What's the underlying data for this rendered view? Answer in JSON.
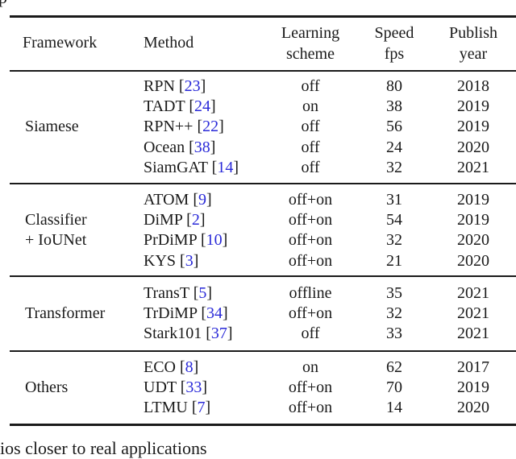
{
  "top_fragment": "p",
  "table": {
    "headers": {
      "framework": "Framework",
      "method": "Method",
      "learning_line1": "Learning",
      "learning_line2": "scheme",
      "speed_line1": "Speed",
      "speed_line2": "fps",
      "year_line1": "Publish",
      "year_line2": "year"
    },
    "groups": [
      {
        "framework": [
          "Siamese"
        ],
        "rows": [
          {
            "method": "RPN",
            "cite": "23",
            "scheme": "off",
            "fps": "80",
            "year": "2018"
          },
          {
            "method": "TADT",
            "cite": "24",
            "scheme": "on",
            "fps": "38",
            "year": "2019"
          },
          {
            "method": "RPN++",
            "cite": "22",
            "scheme": "off",
            "fps": "56",
            "year": "2019"
          },
          {
            "method": "Ocean",
            "cite": "38",
            "scheme": "off",
            "fps": "24",
            "year": "2020"
          },
          {
            "method": "SiamGAT",
            "cite": "14",
            "scheme": "off",
            "fps": "32",
            "year": "2021"
          }
        ]
      },
      {
        "framework": [
          "Classifier",
          "+ IoUNet"
        ],
        "rows": [
          {
            "method": "ATOM",
            "cite": "9",
            "scheme": "off+on",
            "fps": "31",
            "year": "2019"
          },
          {
            "method": "DiMP",
            "cite": "2",
            "scheme": "off+on",
            "fps": "54",
            "year": "2019"
          },
          {
            "method": "PrDiMP",
            "cite": "10",
            "scheme": "off+on",
            "fps": "32",
            "year": "2020"
          },
          {
            "method": "KYS",
            "cite": "3",
            "scheme": "off+on",
            "fps": "21",
            "year": "2020"
          }
        ]
      },
      {
        "framework": [
          "Transformer"
        ],
        "rows": [
          {
            "method": "TransT",
            "cite": "5",
            "scheme": "offline",
            "fps": "35",
            "year": "2021"
          },
          {
            "method": "TrDiMP",
            "cite": "34",
            "scheme": "off+on",
            "fps": "32",
            "year": "2021"
          },
          {
            "method": "Stark101",
            "cite": "37",
            "scheme": "off",
            "fps": "33",
            "year": "2021"
          }
        ]
      },
      {
        "framework": [
          "Others"
        ],
        "rows": [
          {
            "method": "ECO",
            "cite": "8",
            "scheme": "on",
            "fps": "62",
            "year": "2017"
          },
          {
            "method": "UDT",
            "cite": "33",
            "scheme": "off+on",
            "fps": "70",
            "year": "2019"
          },
          {
            "method": "LTMU",
            "cite": "7",
            "scheme": "off+on",
            "fps": "14",
            "year": "2020"
          }
        ]
      }
    ]
  },
  "bottom_fragment": "ios closer to real applications",
  "colors": {
    "citation": "#2a2ad8",
    "text": "#1a1a1a"
  }
}
